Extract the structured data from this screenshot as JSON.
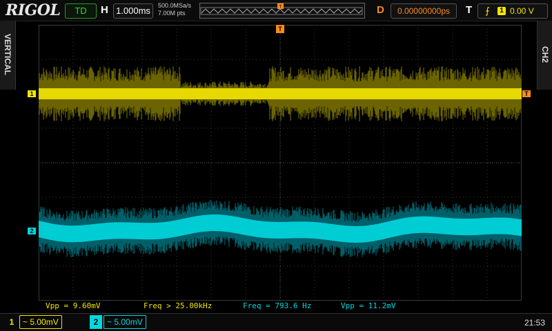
{
  "brand": "RIGOL",
  "top": {
    "run_state": "TD",
    "h_label": "H",
    "timebase": "1.000ms",
    "sample_rate": "500.0MSa/s",
    "mem_depth": "7.00M pts",
    "delay_label": "D",
    "delay_value": "0.00000000ps",
    "trigger_label": "T",
    "trigger_source": "1",
    "trigger_level": "0.00 V"
  },
  "side": {
    "left_tab": "VERTICAL",
    "right_tab": "CH2"
  },
  "markers": {
    "ch1": "1",
    "ch2": "2",
    "trigger": "T",
    "position": "T"
  },
  "measurements": [
    {
      "label": "Vpp = 9.60mV",
      "color": "#f4e600"
    },
    {
      "label": "Freq > 25.00kHz",
      "color": "#f4e600"
    },
    {
      "label": "Freq = 793.6 Hz",
      "color": "#00d8e0"
    },
    {
      "label": "Vpp = 11.2mV",
      "color": "#00d8e0"
    }
  ],
  "channels": [
    {
      "num": "1",
      "scale": "~ 5.00mV",
      "color": "#f4e600"
    },
    {
      "num": "2",
      "scale": "~ 5.00mV",
      "color": "#00d8e0"
    }
  ],
  "clock": "21:53",
  "colors": {
    "ch1": "#f4e600",
    "ch2": "#00d8e0",
    "trigger": "#ff8c1a",
    "grid": "#3a3a3a"
  }
}
